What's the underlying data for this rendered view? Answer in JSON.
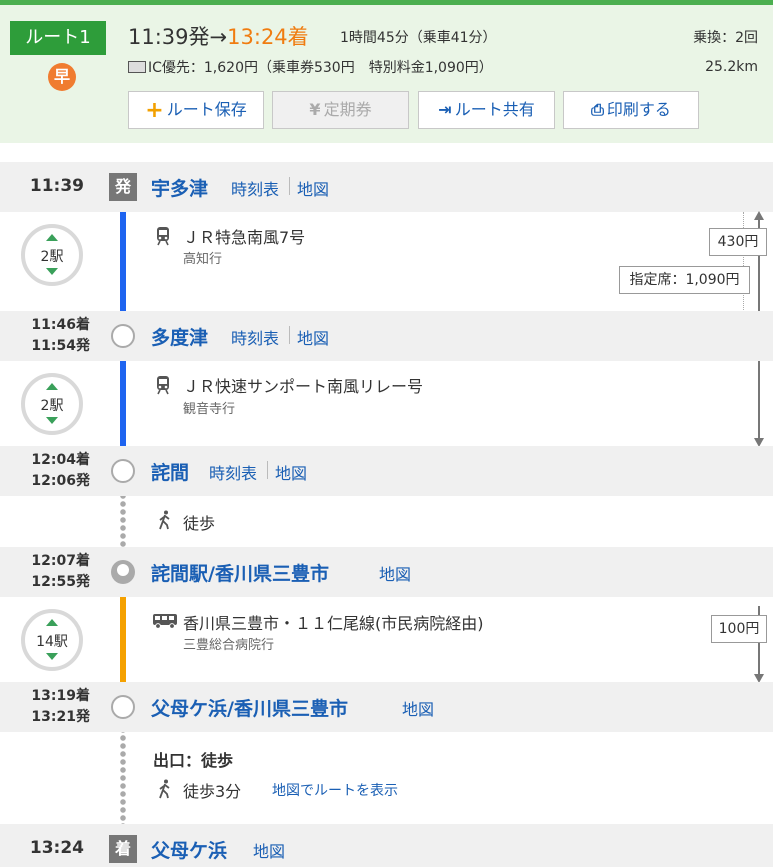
{
  "header": {
    "route_label": "ルート1",
    "early_badge": "早",
    "depart_time": "11:39発",
    "arrow": "→",
    "arrive_time": "13:24着",
    "duration": "1時間45分（乗車41分）",
    "fare": "IC優先：1,620円（乗車券530円　特別料金1,090円）",
    "transfers": "乗換：2回",
    "distance": "25.2km",
    "buttons": {
      "save": "ルート保存",
      "pass": "定期券",
      "share": "ルート共有",
      "print": "印刷する"
    }
  },
  "stations": [
    {
      "time": "11:39",
      "badge": "発",
      "name": "宇多津",
      "timetable": "時刻表",
      "map": "地図"
    },
    {
      "arr": "11:46着",
      "dep": "11:54発",
      "name": "多度津",
      "timetable": "時刻表",
      "map": "地図"
    },
    {
      "arr": "12:04着",
      "dep": "12:06発",
      "name": "詫間",
      "timetable": "時刻表",
      "map": "地図"
    },
    {
      "arr": "12:07着",
      "dep": "12:55発",
      "name": "詫間駅/香川県三豊市",
      "map": "地図"
    },
    {
      "arr": "13:19着",
      "dep": "13:21発",
      "name": "父母ケ浜/香川県三豊市",
      "map": "地図"
    },
    {
      "time": "13:24",
      "badge": "着",
      "name": "父母ケ浜",
      "map": "地図"
    }
  ],
  "segments": [
    {
      "stops": "2駅",
      "train": "ＪＲ特急南風7号",
      "dest": "高知行",
      "fare": "430円",
      "reserved": "指定席：1,090円"
    },
    {
      "stops": "2駅",
      "train": "ＪＲ快速サンポート南風リレー号",
      "dest": "観音寺行"
    },
    {
      "walk": "徒歩"
    },
    {
      "stops": "14駅",
      "train": "香川県三豊市・１１仁尾線(市民病院経由)",
      "dest": "三豊総合病院行",
      "fare": "100円"
    },
    {
      "exit": "出口：徒歩",
      "walk": "徒歩3分",
      "walk_link": "地図でルートを表示"
    }
  ],
  "colors": {
    "accent_green": "#2e9d3a",
    "line_blue": "#1e64f0",
    "line_orange": "#f5a100",
    "link": "#1a5fb4",
    "arrive_orange": "#f07c10"
  }
}
